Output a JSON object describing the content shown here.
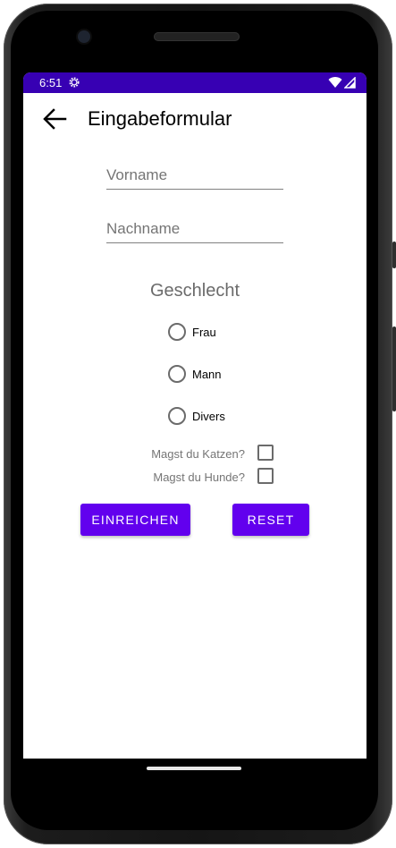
{
  "status_bar": {
    "time": "6:51",
    "background": "#3700b3"
  },
  "app_bar": {
    "title": "Eingabeformular"
  },
  "form": {
    "first_name": {
      "value": "",
      "placeholder": "Vorname"
    },
    "last_name": {
      "value": "",
      "placeholder": "Nachname"
    },
    "gender": {
      "title": "Geschlecht",
      "options": [
        {
          "label": "Frau",
          "selected": false
        },
        {
          "label": "Mann",
          "selected": false
        },
        {
          "label": "Divers",
          "selected": false
        }
      ]
    },
    "checkboxes": [
      {
        "label": "Magst du Katzen?",
        "checked": false
      },
      {
        "label": "Magst du Hunde?",
        "checked": false
      }
    ],
    "submit_label": "EINREICHEN",
    "reset_label": "RESET"
  },
  "colors": {
    "primary": "#6200ee",
    "primary_dark": "#3700b3"
  },
  "icons": {
    "back": "arrow-left-icon",
    "settings": "gear-icon",
    "wifi": "wifi-icon",
    "signal": "signal-icon"
  }
}
